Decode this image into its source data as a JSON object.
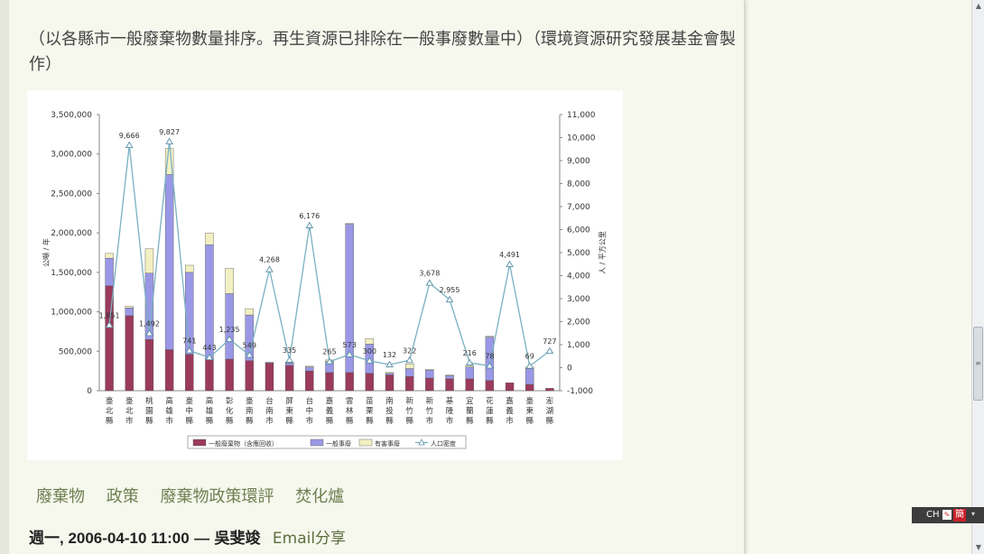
{
  "caption": "（以各縣市一般廢棄物數量排序。再生資源已排除在一般事廢數量中）（環境資源研究發展基金會製作）",
  "tags": [
    "廢棄物",
    "政策",
    "廢棄物政策環評",
    "焚化爐"
  ],
  "meta": {
    "date": "週一, 2006-04-10 11:00",
    "dash": "—",
    "author": "吳斐竣",
    "share": "Email分享"
  },
  "ime": {
    "label": "CH",
    "badge": "簡"
  },
  "colors": {
    "general": "#9b3a5c",
    "business": "#9a98e6",
    "hazardous": "#f2f0c2",
    "density": "#7ab0c2"
  },
  "chart_data": {
    "type": "bar",
    "stacked": true,
    "categories": [
      "臺北縣",
      "臺北市",
      "桃園縣",
      "高雄市",
      "臺中縣",
      "高雄縣",
      "彰化縣",
      "臺南縣",
      "台南市",
      "屏東縣",
      "台中市",
      "嘉義縣",
      "雲林縣",
      "苗栗縣",
      "南投縣",
      "新竹縣",
      "新竹市",
      "基隆市",
      "宜蘭縣",
      "花蓮縣",
      "嘉義市",
      "臺東縣",
      "澎湖縣"
    ],
    "ylabel_left": "公噸 / 年",
    "ylabel_right": "人 / 平方公里",
    "ylim_left": [
      0,
      3500000
    ],
    "ylim_right": [
      -1000,
      11000
    ],
    "left_ticks": [
      "3,500,000",
      "3,000,000",
      "2,500,000",
      "2,000,000",
      "1,500,000",
      "1,000,000",
      "500,000",
      "0"
    ],
    "right_ticks": [
      "11,000",
      "10,000",
      "9,000",
      "8,000",
      "7,000",
      "6,000",
      "5,000",
      "4,000",
      "3,000",
      "2,000",
      "1,000",
      "0",
      "-1,000"
    ],
    "series": [
      {
        "name": "一般廢棄物（含應回收）",
        "values": [
          1330000,
          950000,
          650000,
          520000,
          460000,
          400000,
          400000,
          380000,
          350000,
          320000,
          250000,
          230000,
          230000,
          220000,
          200000,
          180000,
          160000,
          150000,
          150000,
          130000,
          100000,
          80000,
          30000
        ]
      },
      {
        "name": "一般事廢",
        "values": [
          350000,
          100000,
          840000,
          2220000,
          1040000,
          1450000,
          830000,
          580000,
          10000,
          30000,
          50000,
          140000,
          1880000,
          370000,
          20000,
          100000,
          100000,
          40000,
          150000,
          550000,
          0,
          200000,
          0
        ]
      },
      {
        "name": "有害事廢",
        "values": [
          60000,
          20000,
          310000,
          330000,
          90000,
          150000,
          320000,
          80000,
          0,
          10000,
          10000,
          20000,
          10000,
          70000,
          10000,
          60000,
          10000,
          10000,
          20000,
          10000,
          0,
          20000,
          0
        ]
      },
      {
        "name": "人口密度",
        "type": "line",
        "values": [
          1851,
          9666,
          1492,
          9827,
          741,
          443,
          1235,
          549,
          4268,
          335,
          6176,
          265,
          573,
          300,
          132,
          322,
          3678,
          2955,
          216,
          78,
          4491,
          69,
          727
        ]
      }
    ],
    "point_labels": [
      "1,851",
      "9,666",
      "1,492",
      "9,827",
      "741",
      "443",
      "1,235",
      "549",
      "4,268",
      "335",
      "6,176",
      "265",
      "573",
      "300",
      "132",
      "322",
      "3,678",
      "2,955",
      "216",
      "78",
      "4,491",
      "69",
      "727"
    ],
    "legend": [
      "一般廢棄物（含應回收）",
      "一般事廢",
      "有害事廢",
      "人口密度"
    ],
    "legend_position": "bottom"
  }
}
